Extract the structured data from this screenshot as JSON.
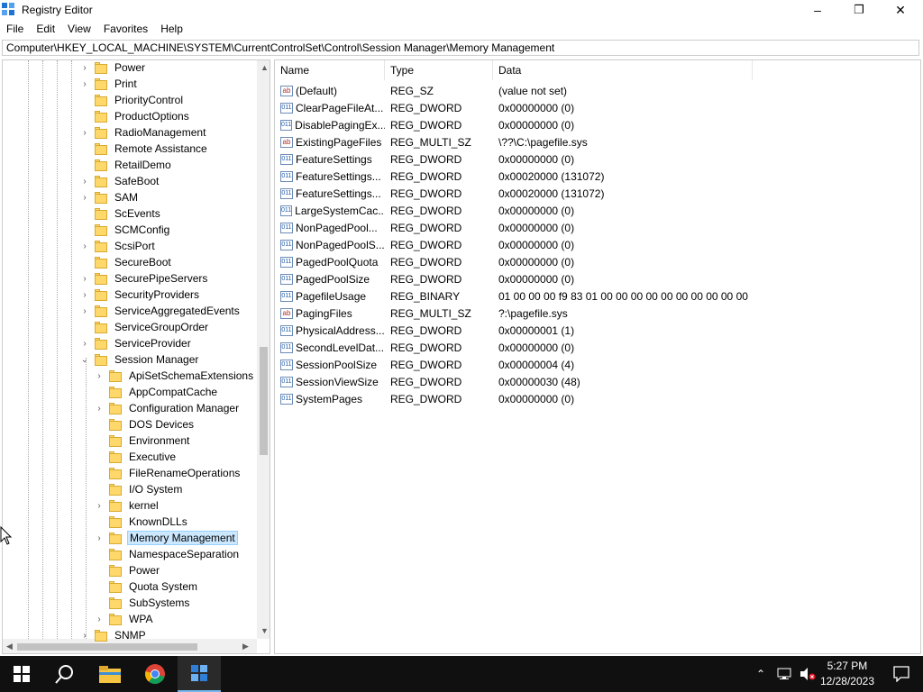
{
  "window": {
    "title": "Registry Editor",
    "minimize": "–",
    "maximize": "❐",
    "close": "✕"
  },
  "menu": [
    "File",
    "Edit",
    "View",
    "Favorites",
    "Help"
  ],
  "address": "Computer\\HKEY_LOCAL_MACHINE\\SYSTEM\\CurrentControlSet\\Control\\Session Manager\\Memory Management",
  "tree": {
    "level1": [
      {
        "label": "Power",
        "expandable": true
      },
      {
        "label": "Print",
        "expandable": true
      },
      {
        "label": "PriorityControl",
        "expandable": false
      },
      {
        "label": "ProductOptions",
        "expandable": false
      },
      {
        "label": "RadioManagement",
        "expandable": true
      },
      {
        "label": "Remote Assistance",
        "expandable": false
      },
      {
        "label": "RetailDemo",
        "expandable": false
      },
      {
        "label": "SafeBoot",
        "expandable": true
      },
      {
        "label": "SAM",
        "expandable": true
      },
      {
        "label": "ScEvents",
        "expandable": false
      },
      {
        "label": "SCMConfig",
        "expandable": false
      },
      {
        "label": "ScsiPort",
        "expandable": true
      },
      {
        "label": "SecureBoot",
        "expandable": false
      },
      {
        "label": "SecurePipeServers",
        "expandable": true
      },
      {
        "label": "SecurityProviders",
        "expandable": true
      },
      {
        "label": "ServiceAggregatedEvents",
        "expandable": true
      },
      {
        "label": "ServiceGroupOrder",
        "expandable": false
      },
      {
        "label": "ServiceProvider",
        "expandable": true
      },
      {
        "label": "Session Manager",
        "expandable": true,
        "expanded": true
      }
    ],
    "level2": [
      {
        "label": "ApiSetSchemaExtensions",
        "expandable": true
      },
      {
        "label": "AppCompatCache",
        "expandable": false
      },
      {
        "label": "Configuration Manager",
        "expandable": true
      },
      {
        "label": "DOS Devices",
        "expandable": false
      },
      {
        "label": "Environment",
        "expandable": false
      },
      {
        "label": "Executive",
        "expandable": false
      },
      {
        "label": "FileRenameOperations",
        "expandable": false
      },
      {
        "label": "I/O System",
        "expandable": false
      },
      {
        "label": "kernel",
        "expandable": true
      },
      {
        "label": "KnownDLLs",
        "expandable": false
      },
      {
        "label": "Memory Management",
        "expandable": true,
        "selected": true
      },
      {
        "label": "NamespaceSeparation",
        "expandable": false
      },
      {
        "label": "Power",
        "expandable": false
      },
      {
        "label": "Quota System",
        "expandable": false
      },
      {
        "label": "SubSystems",
        "expandable": false
      },
      {
        "label": "WPA",
        "expandable": true
      }
    ],
    "after": [
      {
        "label": "SNMP",
        "expandable": true
      }
    ]
  },
  "columns": {
    "name": "Name",
    "type": "Type",
    "data": "Data"
  },
  "values": [
    {
      "name": "(Default)",
      "type": "REG_SZ",
      "data": "(value not set)",
      "icon": "string"
    },
    {
      "name": "ClearPageFileAt...",
      "type": "REG_DWORD",
      "data": "0x00000000 (0)",
      "icon": "binary"
    },
    {
      "name": "DisablePagingEx...",
      "type": "REG_DWORD",
      "data": "0x00000000 (0)",
      "icon": "binary"
    },
    {
      "name": "ExistingPageFiles",
      "type": "REG_MULTI_SZ",
      "data": "\\??\\C:\\pagefile.sys",
      "icon": "string"
    },
    {
      "name": "FeatureSettings",
      "type": "REG_DWORD",
      "data": "0x00000000 (0)",
      "icon": "binary"
    },
    {
      "name": "FeatureSettings...",
      "type": "REG_DWORD",
      "data": "0x00020000 (131072)",
      "icon": "binary"
    },
    {
      "name": "FeatureSettings...",
      "type": "REG_DWORD",
      "data": "0x00020000 (131072)",
      "icon": "binary"
    },
    {
      "name": "LargeSystemCac...",
      "type": "REG_DWORD",
      "data": "0x00000000 (0)",
      "icon": "binary"
    },
    {
      "name": "NonPagedPool...",
      "type": "REG_DWORD",
      "data": "0x00000000 (0)",
      "icon": "binary"
    },
    {
      "name": "NonPagedPoolS...",
      "type": "REG_DWORD",
      "data": "0x00000000 (0)",
      "icon": "binary"
    },
    {
      "name": "PagedPoolQuota",
      "type": "REG_DWORD",
      "data": "0x00000000 (0)",
      "icon": "binary"
    },
    {
      "name": "PagedPoolSize",
      "type": "REG_DWORD",
      "data": "0x00000000 (0)",
      "icon": "binary"
    },
    {
      "name": "PagefileUsage",
      "type": "REG_BINARY",
      "data": "01 00 00 00 f9 83 01 00 00 00 00 00 00 00 00 00 00 00 00...",
      "icon": "binary"
    },
    {
      "name": "PagingFiles",
      "type": "REG_MULTI_SZ",
      "data": "?:\\pagefile.sys",
      "icon": "string"
    },
    {
      "name": "PhysicalAddress...",
      "type": "REG_DWORD",
      "data": "0x00000001 (1)",
      "icon": "binary"
    },
    {
      "name": "SecondLevelDat...",
      "type": "REG_DWORD",
      "data": "0x00000000 (0)",
      "icon": "binary"
    },
    {
      "name": "SessionPoolSize",
      "type": "REG_DWORD",
      "data": "0x00000004 (4)",
      "icon": "binary"
    },
    {
      "name": "SessionViewSize",
      "type": "REG_DWORD",
      "data": "0x00000030 (48)",
      "icon": "binary"
    },
    {
      "name": "SystemPages",
      "type": "REG_DWORD",
      "data": "0x00000000 (0)",
      "icon": "binary"
    }
  ],
  "taskbar": {
    "time": "5:27 PM",
    "date": "12/28/2023",
    "icons": [
      "windows-start-icon",
      "search-icon",
      "file-explorer-icon",
      "chrome-icon",
      "regedit-icon"
    ]
  }
}
